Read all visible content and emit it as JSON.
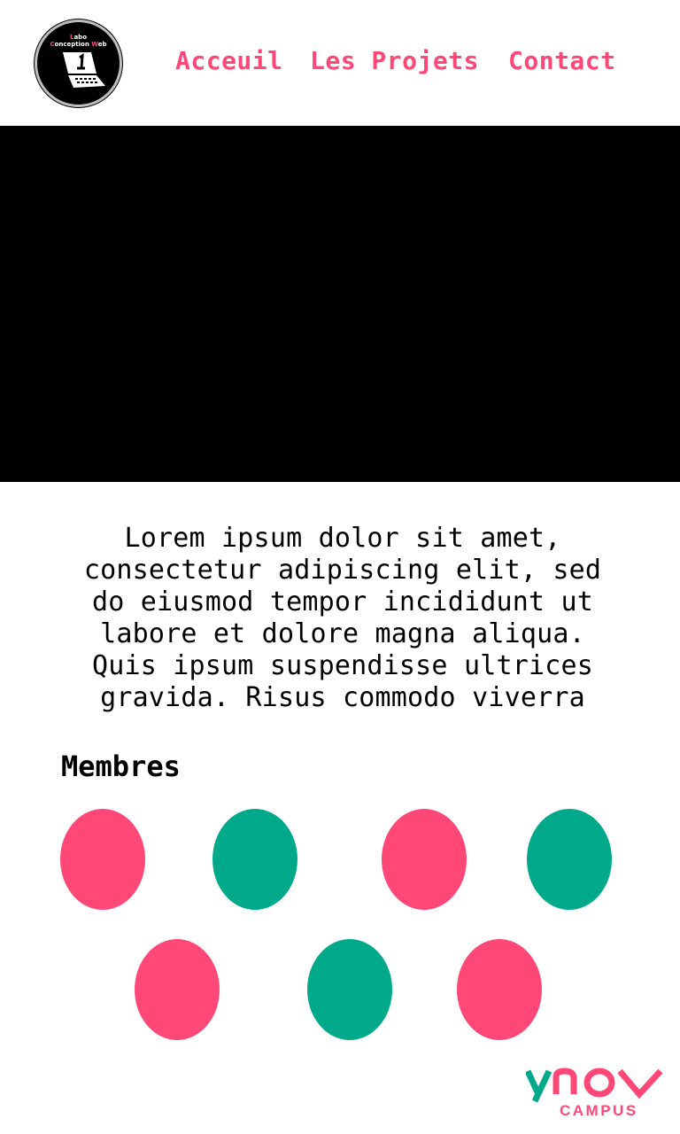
{
  "header": {
    "logo": {
      "line1": "Labo",
      "line2": "Conception Web"
    },
    "nav": [
      {
        "label": "Acceuil"
      },
      {
        "label": "Les Projets"
      },
      {
        "label": "Contact"
      }
    ]
  },
  "intro": {
    "text": "Lorem ipsum dolor sit amet, consectetur adipiscing elit, sed do eiusmod tempor incididunt ut labore et dolore magna aliqua. Quis ipsum suspendisse ultrices gravida. Risus commodo viverra"
  },
  "members": {
    "title": "Membres",
    "items": [
      {
        "color": "#ff4778"
      },
      {
        "color": "#00a98a"
      },
      {
        "color": "#ff4778"
      },
      {
        "color": "#00a98a"
      },
      {
        "color": "#ff4778"
      },
      {
        "color": "#00a98a"
      },
      {
        "color": "#ff4778"
      }
    ]
  },
  "footer": {
    "brand": "ynov",
    "sub": "CAMPUS"
  },
  "colors": {
    "accent_pink": "#ff4778",
    "accent_green": "#00a98a",
    "hero_background": "#000000"
  }
}
